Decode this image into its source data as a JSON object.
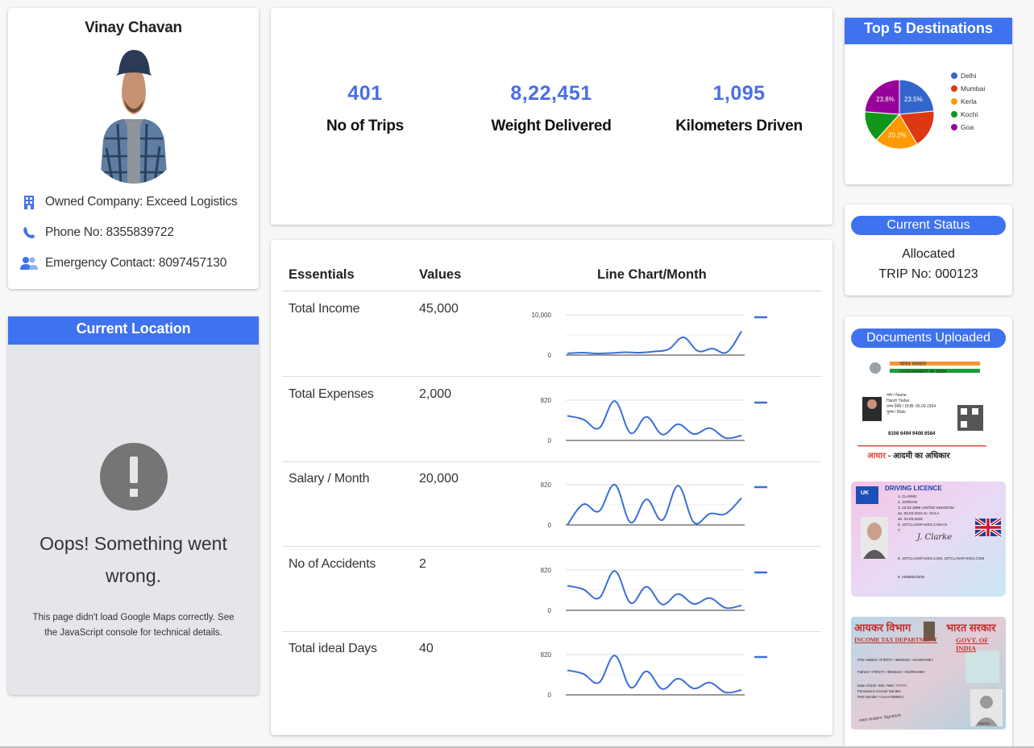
{
  "profile": {
    "name": "Vinay Chavan",
    "company": "Owned Company: Exceed Logistics",
    "phone": "Phone No: 8355839722",
    "emergency": "Emergency Contact: 8097457130"
  },
  "stats": [
    {
      "value": "401",
      "label": "No of Trips"
    },
    {
      "value": "8,22,451",
      "label": "Weight Delivered"
    },
    {
      "value": "1,095",
      "label": "Kilometers Driven"
    }
  ],
  "table": {
    "headers": [
      "Essentials",
      "Values",
      "Line Chart/Month"
    ],
    "rows": [
      {
        "name": "Total Income",
        "value": "45,000"
      },
      {
        "name": "Total Expenses",
        "value": "2,000"
      },
      {
        "name": "Salary / Month",
        "value": "20,000"
      },
      {
        "name": "No of Accidents",
        "value": "2"
      },
      {
        "name": "Total ideal Days",
        "value": "40"
      }
    ]
  },
  "location": {
    "title": "Current Location",
    "error_title": "Oops! Something went wrong.",
    "error_detail": "This page didn't load Google Maps correctly. See the JavaScript console for technical details."
  },
  "destinations": {
    "title": "Top 5 Destinations",
    "slices": [
      {
        "label": "Delhi",
        "pct": 23.5,
        "color": "#3366cc"
      },
      {
        "label": "Mumbai",
        "pct": 18.0,
        "color": "#dc3912"
      },
      {
        "label": "Kerla",
        "pct": 20.2,
        "color": "#ff9900"
      },
      {
        "label": "Kochi",
        "pct": 14.5,
        "color": "#109618"
      },
      {
        "label": "Goa",
        "pct": 23.8,
        "color": "#990099"
      }
    ],
    "slice_labels": [
      "23.5%",
      "20.2%",
      "23.8%"
    ]
  },
  "status": {
    "title": "Current Status",
    "state": "Allocated",
    "trip": "TRIP No: 000123"
  },
  "documents": {
    "title": "Documents Uploaded",
    "aadhaar": {
      "header": "भारत सरकार",
      "subheader": "GOVERNMENT OF INDIA",
      "lines": [
        "नाम / Name:",
        "Harsh Yadav",
        "जन्म तिथि / DOB: 06.09.1994",
        "पुरुष / Male"
      ],
      "number": "8108 6494 9408 6584",
      "footer_left": "आधार",
      "footer_right": " - आदमी का अधिकार"
    },
    "licence": {
      "title": "DRIVING LICENCE",
      "country": "UK",
      "lines": [
        "1. CLARKE",
        "2. JORDAN",
        "3. 22.03.1998 UNITED KINGDOM",
        "4a. 05.03.2016  4c. DVLA",
        "4b. 04.03.2026",
        "5. 10TCLASSFAKES.COM 01",
        "7.",
        "8. 10TCLASSFAKES.COM, 10TCLASSFAKES.COM",
        "9. AM/B/B1/B/W"
      ],
      "signature": "J. Clarke"
    },
    "pan": {
      "hindi_left": "आयकर विभाग",
      "hindi_right": "भारत सरकार",
      "dept": "INCOME TAX DEPARTMENT",
      "govt": "GOVT. OF INDIA",
      "lines": [
        "PAN Holders' <FIRST> <MIDDLE> <SURNAME>",
        "Fathers' <FIRST> <MIDDLE> <SURNAME>",
        "Date of birth <DD / MM / YYYY>",
        "Permanent Account Number",
        "PAN Number <AAAAA9999A>"
      ],
      "signature": "PAN Holders' Signature",
      "photo": "PHOTO"
    }
  },
  "chart_data": [
    {
      "type": "line",
      "title": "Total Income",
      "yticks": [
        "10,000",
        "0"
      ],
      "ylim": [
        0,
        10000
      ],
      "values": [
        400,
        600,
        400,
        500,
        700,
        600,
        900,
        1500,
        4400,
        1000,
        1600,
        700,
        5900
      ]
    },
    {
      "type": "line",
      "title": "Total Expenses",
      "yticks": [
        "820",
        "0"
      ],
      "ylim": [
        0,
        820
      ],
      "values": [
        500,
        430,
        250,
        800,
        150,
        480,
        120,
        330,
        130,
        250,
        50,
        100
      ]
    },
    {
      "type": "line",
      "title": "Salary / Month",
      "yticks": [
        "820",
        "0"
      ],
      "ylim": [
        0,
        820
      ],
      "values": [
        0,
        420,
        280,
        820,
        50,
        520,
        100,
        800,
        50,
        230,
        230,
        550
      ]
    },
    {
      "type": "line",
      "title": "No of Accidents",
      "yticks": [
        "820",
        "0"
      ],
      "ylim": [
        0,
        820
      ],
      "values": [
        500,
        430,
        250,
        800,
        150,
        480,
        120,
        330,
        130,
        250,
        50,
        100
      ]
    },
    {
      "type": "line",
      "title": "Total ideal Days",
      "yticks": [
        "820",
        "0"
      ],
      "ylim": [
        0,
        820
      ],
      "values": [
        500,
        430,
        250,
        800,
        150,
        480,
        120,
        330,
        130,
        250,
        50,
        100
      ]
    }
  ],
  "colors": {
    "accent": "#3f72ee",
    "stat_value": "#4a6ee8",
    "line": "#3b6fd8"
  }
}
